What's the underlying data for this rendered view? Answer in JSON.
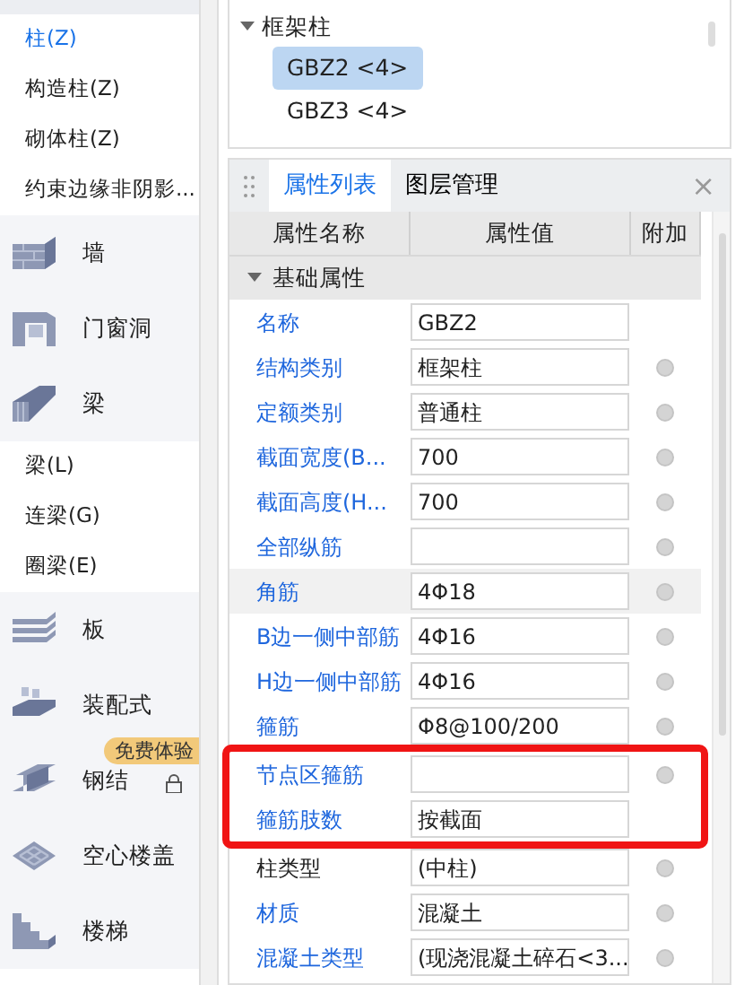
{
  "sidebar": {
    "items": [
      {
        "kind": "sub",
        "label": "柱(Z)",
        "selected": true
      },
      {
        "kind": "sub",
        "label": "构造柱(Z)",
        "selected": false
      },
      {
        "kind": "sub",
        "label": "砌体柱(Z)",
        "selected": false
      },
      {
        "kind": "sub",
        "label": "约束边缘非阴影...",
        "selected": false
      },
      {
        "kind": "category",
        "label": "墙"
      },
      {
        "kind": "category",
        "label": "门窗洞"
      },
      {
        "kind": "category",
        "label": "梁"
      },
      {
        "kind": "sub",
        "label": "梁(L)",
        "selected": false
      },
      {
        "kind": "sub",
        "label": "连梁(G)",
        "selected": false
      },
      {
        "kind": "sub",
        "label": "圈梁(E)",
        "selected": false
      },
      {
        "kind": "category",
        "label": "板"
      },
      {
        "kind": "category",
        "label": "装配式"
      },
      {
        "kind": "category",
        "label": "钢结",
        "badge": "免费体验",
        "locked": true
      },
      {
        "kind": "category",
        "label": "空心楼盖"
      },
      {
        "kind": "category",
        "label": "楼梯"
      }
    ]
  },
  "tree": [
    {
      "label": "框架柱",
      "expanded": true,
      "children": [
        {
          "label": "GBZ2 <4>",
          "selected": true
        },
        {
          "label": "GBZ3 <4>",
          "selected": false
        }
      ]
    }
  ],
  "properties": {
    "tabs": [
      {
        "label": "属性列表",
        "selected": true
      },
      {
        "label": "图层管理",
        "selected": false
      }
    ],
    "close": "×",
    "columns": [
      "属性名称",
      "属性值",
      "附加"
    ],
    "group": {
      "label": "基础属性",
      "expanded": true
    },
    "rows": [
      {
        "name": "名称",
        "value": "GBZ2",
        "public": true,
        "extra": false,
        "selected": false,
        "highlighted": false
      },
      {
        "name": "结构类别",
        "value": "框架柱",
        "public": true,
        "extra": true,
        "selected": false,
        "highlighted": false
      },
      {
        "name": "定额类别",
        "value": "普通柱",
        "public": true,
        "extra": true,
        "selected": false,
        "highlighted": false
      },
      {
        "name": "截面宽度(B...",
        "value": "700",
        "public": true,
        "extra": true,
        "selected": false,
        "highlighted": false
      },
      {
        "name": "截面高度(H...",
        "value": "700",
        "public": true,
        "extra": true,
        "selected": false,
        "highlighted": false
      },
      {
        "name": "全部纵筋",
        "value": "",
        "public": true,
        "extra": true,
        "selected": false,
        "highlighted": false
      },
      {
        "name": "角筋",
        "value": "4Φ18",
        "public": true,
        "extra": true,
        "selected": true,
        "highlighted": false
      },
      {
        "name": "B边一侧中部筋",
        "value": "4Φ16",
        "public": true,
        "extra": true,
        "selected": false,
        "highlighted": false
      },
      {
        "name": "H边一侧中部筋",
        "value": "4Φ16",
        "public": true,
        "extra": true,
        "selected": false,
        "highlighted": false
      },
      {
        "name": "箍筋",
        "value": "Φ8@100/200",
        "public": true,
        "extra": true,
        "selected": false,
        "highlighted": false
      },
      {
        "name": "节点区箍筋",
        "value": "",
        "public": true,
        "extra": true,
        "selected": false,
        "highlighted": true
      },
      {
        "name": "箍筋肢数",
        "value": "按截面",
        "public": true,
        "extra": false,
        "selected": false,
        "highlighted": true
      },
      {
        "name": "柱类型",
        "value": "(中柱)",
        "public": false,
        "extra": true,
        "selected": false,
        "highlighted": false
      },
      {
        "name": "材质",
        "value": "混凝土",
        "public": true,
        "extra": true,
        "selected": false,
        "highlighted": false
      },
      {
        "name": "混凝土类型",
        "value": "(现浇混凝土碎石<3...",
        "public": true,
        "extra": true,
        "selected": false,
        "highlighted": false
      }
    ]
  }
}
